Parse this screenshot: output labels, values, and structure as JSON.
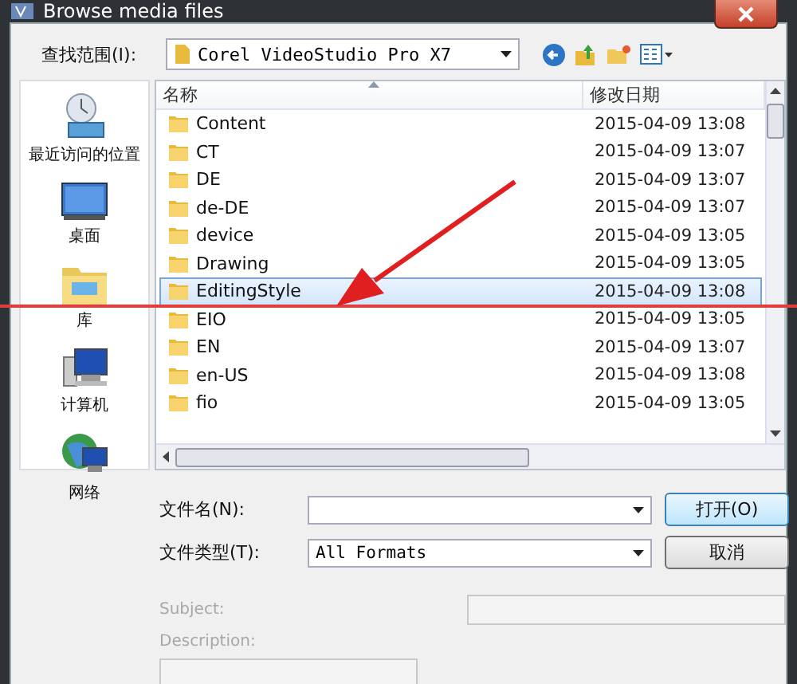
{
  "window": {
    "title": "Browse media files"
  },
  "look_in": {
    "label": "查找范围(I):",
    "value": "Corel VideoStudio Pro X7"
  },
  "places": [
    {
      "label": "最近访问的位置",
      "kind": "recent"
    },
    {
      "label": "桌面",
      "kind": "desktop"
    },
    {
      "label": "库",
      "kind": "library"
    },
    {
      "label": "计算机",
      "kind": "computer"
    },
    {
      "label": "网络",
      "kind": "network"
    }
  ],
  "file_list": {
    "columns": [
      "名称",
      "修改日期"
    ],
    "rows": [
      {
        "name": "Content",
        "modified": "2015-04-09 13:08",
        "selected": false
      },
      {
        "name": "CT",
        "modified": "2015-04-09 13:07",
        "selected": false
      },
      {
        "name": "DE",
        "modified": "2015-04-09 13:07",
        "selected": false
      },
      {
        "name": "de-DE",
        "modified": "2015-04-09 13:07",
        "selected": false
      },
      {
        "name": "device",
        "modified": "2015-04-09 13:05",
        "selected": false
      },
      {
        "name": "Drawing",
        "modified": "2015-04-09 13:05",
        "selected": false
      },
      {
        "name": "EditingStyle",
        "modified": "2015-04-09 13:08",
        "selected": true
      },
      {
        "name": "EIO",
        "modified": "2015-04-09 13:05",
        "selected": false
      },
      {
        "name": "EN",
        "modified": "2015-04-09 13:07",
        "selected": false
      },
      {
        "name": "en-US",
        "modified": "2015-04-09 13:08",
        "selected": false
      },
      {
        "name": "fio",
        "modified": "2015-04-09 13:05",
        "selected": false
      }
    ]
  },
  "file_name": {
    "label": "文件名(N):"
  },
  "file_type": {
    "label": "文件类型(T):",
    "value": "All Formats"
  },
  "buttons": [
    {
      "label": "打开(O)",
      "kind": "default"
    },
    {
      "label": "取消",
      "kind": "normal"
    }
  ],
  "subject": {
    "label": "Subject:",
    "disabled": true
  },
  "description": {
    "label": "Description:",
    "disabled": true
  }
}
